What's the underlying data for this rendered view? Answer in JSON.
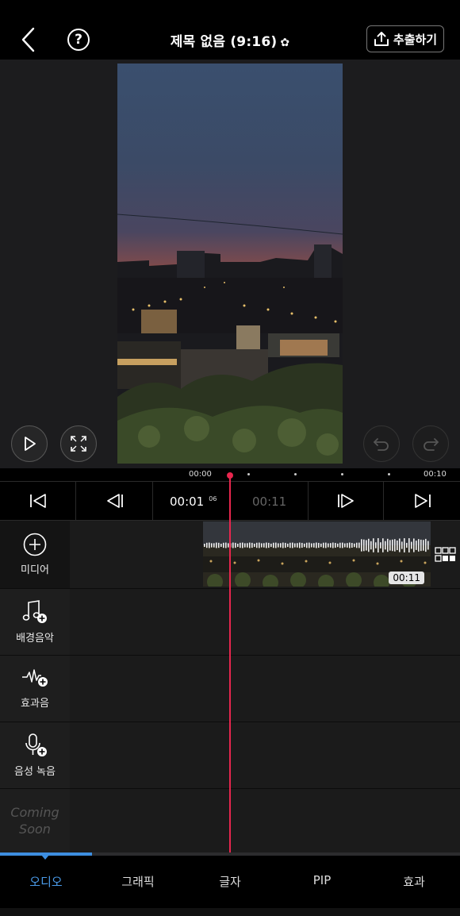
{
  "header": {
    "title": "제목 없음 (9:16)",
    "title_gear": "✿",
    "export_label": "추출하기",
    "help_label": "?"
  },
  "icons": {
    "back": "chevron-left-icon",
    "help": "question-circle-icon",
    "settings": "gear-icon",
    "export": "upload-icon",
    "play": "play-icon",
    "fullscreen": "expand-icon",
    "undo": "undo-icon",
    "redo": "redo-icon"
  },
  "ruler": {
    "start": "00:00",
    "end": "00:10"
  },
  "transport": {
    "current_time": "00:01",
    "current_frame": "06",
    "total_time": "00:11"
  },
  "tracks": {
    "media_label": "미디어",
    "clip_duration": "00:11",
    "bgm_label": "배경음악",
    "sfx_label": "효과음",
    "voice_label": "음성 녹음",
    "coming_line1": "Coming",
    "coming_line2": "Soon"
  },
  "tabs": [
    {
      "label": "오디오",
      "active": true
    },
    {
      "label": "그래픽"
    },
    {
      "label": "글자"
    },
    {
      "label": "PIP"
    },
    {
      "label": "효과"
    }
  ],
  "colors": {
    "accent_blue": "#4a9ae8",
    "playhead": "#e8264e",
    "background": "#000000"
  }
}
